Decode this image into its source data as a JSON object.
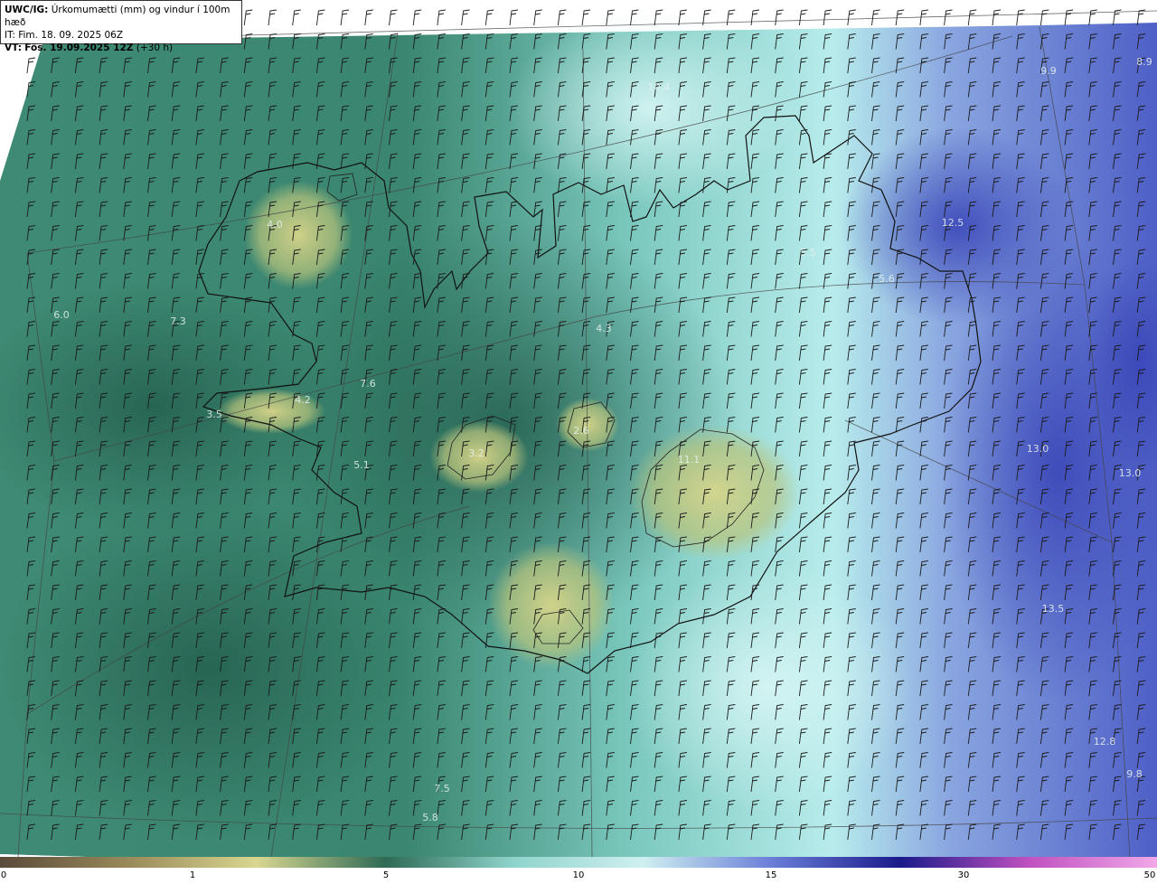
{
  "header": {
    "model": "UWC/IG:",
    "title": "Úrkomumætti (mm) og vindur í 100m hæð",
    "init_time": "IT: Fim. 18. 09. 2025 06Z",
    "valid_label": "VT:",
    "valid_time": "Fös. 19.09.2025 12Z",
    "lead": "(+30 h)"
  },
  "colorbar": {
    "ticks": [
      "0",
      "1",
      "5",
      "10",
      "15",
      "30",
      "50"
    ],
    "colors": [
      "#5a4a3a",
      "#9a8a5a",
      "#d8d690",
      "#2e6a55",
      "#8fd4cc",
      "#cfeff0",
      "#6a7ed8",
      "#1a1a8a",
      "#c050c0",
      "#f0a8e8"
    ]
  },
  "map_labels": [
    {
      "text": "4.0"
    },
    {
      "text": "6.0"
    },
    {
      "text": "7.3"
    },
    {
      "text": "4.2"
    },
    {
      "text": "3.5"
    },
    {
      "text": "3.2"
    },
    {
      "text": "4.3"
    },
    {
      "text": "5.5"
    },
    {
      "text": "5.6"
    },
    {
      "text": "12.5"
    },
    {
      "text": "13.0"
    },
    {
      "text": "13.0"
    },
    {
      "text": "13.5"
    },
    {
      "text": "7.5"
    },
    {
      "text": "5.8"
    },
    {
      "text": "10.4"
    },
    {
      "text": "7.6"
    },
    {
      "text": "8.9"
    },
    {
      "text": "11.1"
    },
    {
      "text": "9.9"
    },
    {
      "text": "5.1"
    },
    {
      "text": "2.6"
    },
    {
      "text": "9.8"
    },
    {
      "text": "12.8"
    }
  ]
}
